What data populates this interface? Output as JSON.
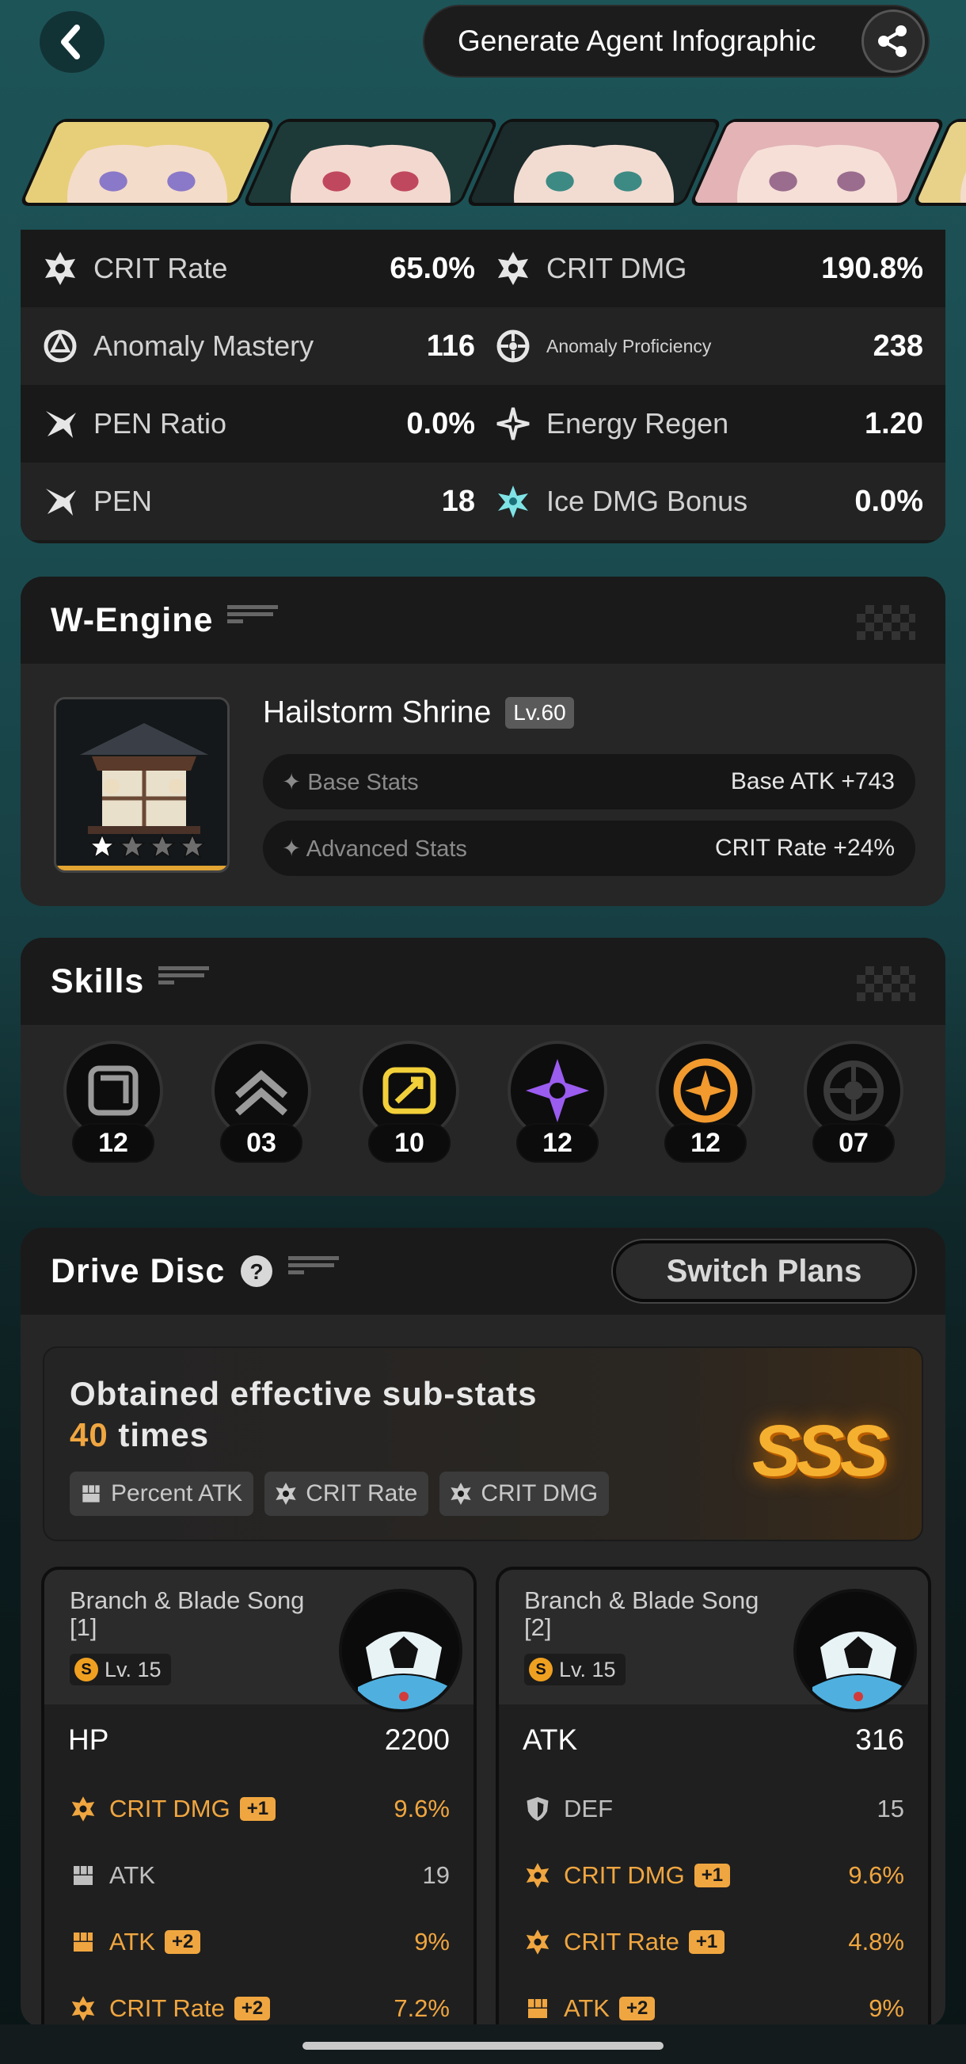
{
  "header": {
    "generate_label": "Generate Agent Infographic"
  },
  "agents": [
    {
      "name": "agent-1",
      "hair": "#e7cf7a",
      "skin": "#f4dccb",
      "eye": "#8a79c8"
    },
    {
      "name": "agent-2",
      "hair": "#1d3a38",
      "skin": "#f3d8cf",
      "eye": "#c0485e"
    },
    {
      "name": "agent-3",
      "hair": "#1b2a2a",
      "skin": "#f2dcd2",
      "eye": "#3d8a84"
    },
    {
      "name": "agent-4",
      "hair": "#e3b3b6",
      "skin": "#f6dfd7",
      "eye": "#9a6d8e"
    },
    {
      "name": "agent-5",
      "hair": "#e8d28a",
      "skin": "#f3dccb",
      "eye": "#888"
    }
  ],
  "stats": [
    {
      "left": {
        "name": "CRIT Rate",
        "value": "65.0%",
        "icon": "crit-rate-icon"
      },
      "right": {
        "name": "CRIT DMG",
        "value": "190.8%",
        "icon": "crit-dmg-icon"
      }
    },
    {
      "left": {
        "name": "Anomaly Mastery",
        "value": "116",
        "icon": "anomaly-mastery-icon"
      },
      "right": {
        "name": "Anomaly Proficiency",
        "value": "238",
        "icon": "anomaly-proficiency-icon"
      }
    },
    {
      "left": {
        "name": "PEN Ratio",
        "value": "0.0%",
        "icon": "pen-ratio-icon"
      },
      "right": {
        "name": "Energy Regen",
        "value": "1.20",
        "icon": "energy-regen-icon"
      }
    },
    {
      "left": {
        "name": "PEN",
        "value": "18",
        "icon": "pen-icon"
      },
      "right": {
        "name": "Ice DMG Bonus",
        "value": "0.0%",
        "icon": "ice-dmg-icon"
      }
    }
  ],
  "wengine": {
    "title": "W-Engine",
    "name": "Hailstorm Shrine",
    "level": "Lv.60",
    "base_label": "Base Stats",
    "base_value": "Base ATK +743",
    "adv_label": "Advanced Stats",
    "adv_value": "CRIT Rate +24%",
    "rank": 1,
    "max_rank": 5
  },
  "skills": {
    "title": "Skills",
    "items": [
      {
        "name": "basic-attack",
        "level": "12",
        "color": "#9a9a9a"
      },
      {
        "name": "dodge",
        "level": "03",
        "color": "#9a9a9a"
      },
      {
        "name": "assist",
        "level": "10",
        "color": "#f2d03a"
      },
      {
        "name": "special-attack",
        "level": "12",
        "color": "#9b5cf0"
      },
      {
        "name": "chain-attack",
        "level": "12",
        "color": "#f29a2e"
      },
      {
        "name": "core-skill",
        "level": "07",
        "color": "#555555"
      }
    ]
  },
  "drive_disc": {
    "title": "Drive Disc",
    "switch_label": "Switch Plans",
    "obtained_prefix": "Obtained effective sub-stats",
    "obtained_count": "40",
    "obtained_suffix": " times",
    "grade": "SSS",
    "tags": [
      "Percent ATK",
      "CRIT Rate",
      "CRIT DMG"
    ],
    "discs": [
      {
        "name": "Branch & Blade Song [1]",
        "level": "Lv. 15",
        "main_stat": "HP",
        "main_value": "2200",
        "subs": [
          {
            "name": "CRIT DMG",
            "plus": "+1",
            "value": "9.6%",
            "highlight": true,
            "icon": "crit-dmg-icon"
          },
          {
            "name": "ATK",
            "plus": "",
            "value": "19",
            "highlight": false,
            "icon": "atk-icon"
          },
          {
            "name": "ATK",
            "plus": "+2",
            "value": "9%",
            "highlight": true,
            "icon": "atk-icon"
          },
          {
            "name": "CRIT Rate",
            "plus": "+2",
            "value": "7.2%",
            "highlight": true,
            "icon": "crit-rate-icon"
          }
        ]
      },
      {
        "name": "Branch & Blade Song [2]",
        "level": "Lv. 15",
        "main_stat": "ATK",
        "main_value": "316",
        "subs": [
          {
            "name": "DEF",
            "plus": "",
            "value": "15",
            "highlight": false,
            "icon": "def-icon"
          },
          {
            "name": "CRIT DMG",
            "plus": "+1",
            "value": "9.6%",
            "highlight": true,
            "icon": "crit-dmg-icon"
          },
          {
            "name": "CRIT Rate",
            "plus": "+1",
            "value": "4.8%",
            "highlight": true,
            "icon": "crit-rate-icon"
          },
          {
            "name": "ATK",
            "plus": "+2",
            "value": "9%",
            "highlight": true,
            "icon": "atk-icon"
          }
        ]
      }
    ]
  }
}
